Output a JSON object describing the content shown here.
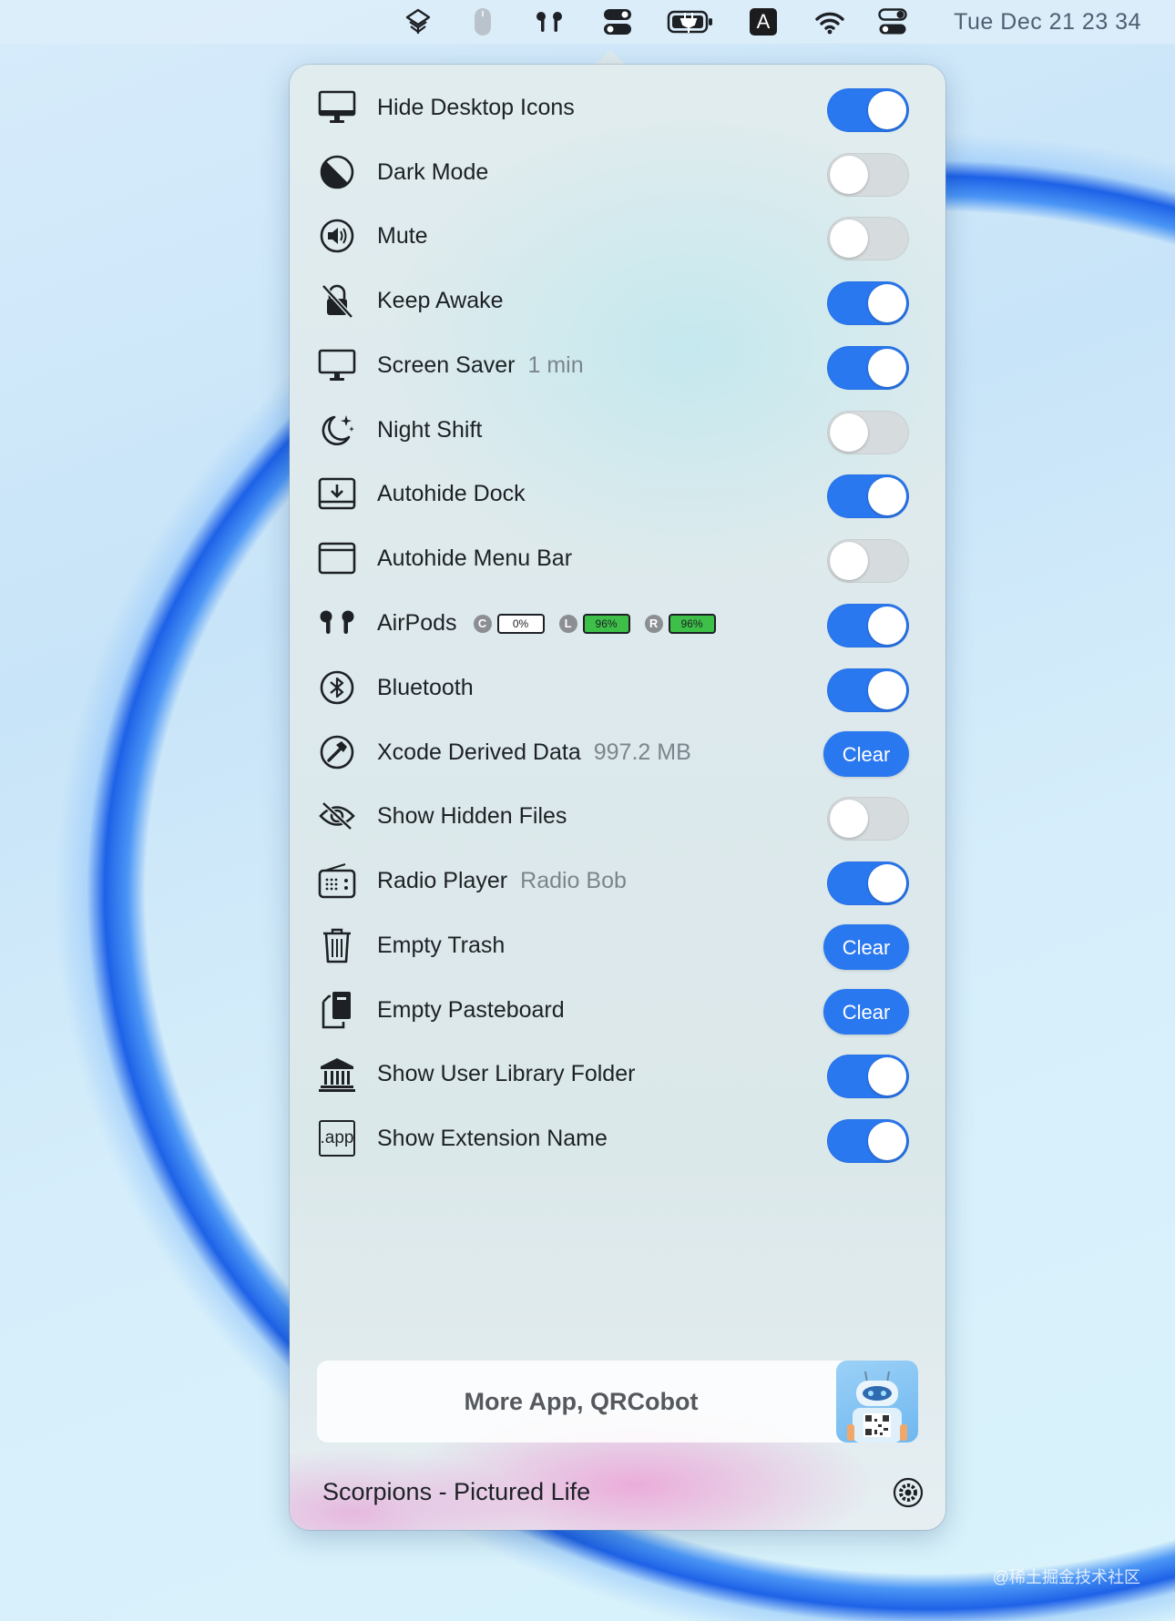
{
  "menubar": {
    "icons": [
      "layers-icon",
      "mouse-icon",
      "airpods-icon",
      "toggles-icon",
      "battery-charging-icon",
      "input-source-icon",
      "wifi-icon",
      "control-center-icon"
    ],
    "input_source": "A",
    "clock": "Tue Dec 21  23 34"
  },
  "items": [
    {
      "icon": "desktop-icon",
      "label": "Hide Desktop Icons",
      "detail": "",
      "control": "toggle",
      "on": true
    },
    {
      "icon": "dark-mode-icon",
      "label": "Dark Mode",
      "detail": "",
      "control": "toggle",
      "on": false
    },
    {
      "icon": "speaker-icon",
      "label": "Mute",
      "detail": "",
      "control": "toggle",
      "on": false
    },
    {
      "icon": "no-sleep-icon",
      "label": "Keep Awake",
      "detail": "",
      "control": "toggle",
      "on": true
    },
    {
      "icon": "monitor-icon",
      "label": "Screen Saver",
      "detail": "1 min",
      "control": "toggle",
      "on": true
    },
    {
      "icon": "moon-stars-icon",
      "label": "Night Shift",
      "detail": "",
      "control": "toggle",
      "on": false
    },
    {
      "icon": "dock-icon",
      "label": "Autohide Dock",
      "detail": "",
      "control": "toggle",
      "on": true
    },
    {
      "icon": "menubar-window-icon",
      "label": "Autohide Menu Bar",
      "detail": "",
      "control": "toggle",
      "on": false
    },
    {
      "icon": "airpods-icon",
      "label": "AirPods",
      "detail": "",
      "control": "toggle",
      "on": true
    },
    {
      "icon": "bluetooth-icon",
      "label": "Bluetooth",
      "detail": "",
      "control": "toggle",
      "on": true
    },
    {
      "icon": "hammer-icon",
      "label": "Xcode Derived Data",
      "detail": "997.2 MB",
      "control": "button",
      "button_label": "Clear"
    },
    {
      "icon": "eye-slash-icon",
      "label": "Show Hidden Files",
      "detail": "",
      "control": "toggle",
      "on": false
    },
    {
      "icon": "radio-icon",
      "label": "Radio Player",
      "detail": "Radio Bob",
      "control": "toggle",
      "on": true
    },
    {
      "icon": "trash-icon",
      "label": "Empty Trash",
      "detail": "",
      "control": "button",
      "button_label": "Clear"
    },
    {
      "icon": "clipboard-icon",
      "label": "Empty Pasteboard",
      "detail": "",
      "control": "button",
      "button_label": "Clear"
    },
    {
      "icon": "library-icon",
      "label": "Show User Library Folder",
      "detail": "",
      "control": "toggle",
      "on": true
    },
    {
      "icon": "app-extension-icon",
      "label": "Show Extension Name",
      "detail": "",
      "control": "toggle",
      "on": true
    }
  ],
  "airpods_battery": [
    {
      "badge": "C",
      "level": "0%",
      "fraction": 0
    },
    {
      "badge": "L",
      "level": "96%",
      "fraction": 0.96
    },
    {
      "badge": "R",
      "level": "96%",
      "fraction": 0.96
    }
  ],
  "extension_icon_text": ".app",
  "promo": {
    "label": "More App, QRCobot"
  },
  "now_playing": "Scorpions - Pictured Life",
  "watermark": "@稀土掘金技术社区",
  "colors": {
    "accent": "#2a78f0",
    "battery_green": "#3dbf48",
    "toggle_off": "#d6dcde"
  }
}
